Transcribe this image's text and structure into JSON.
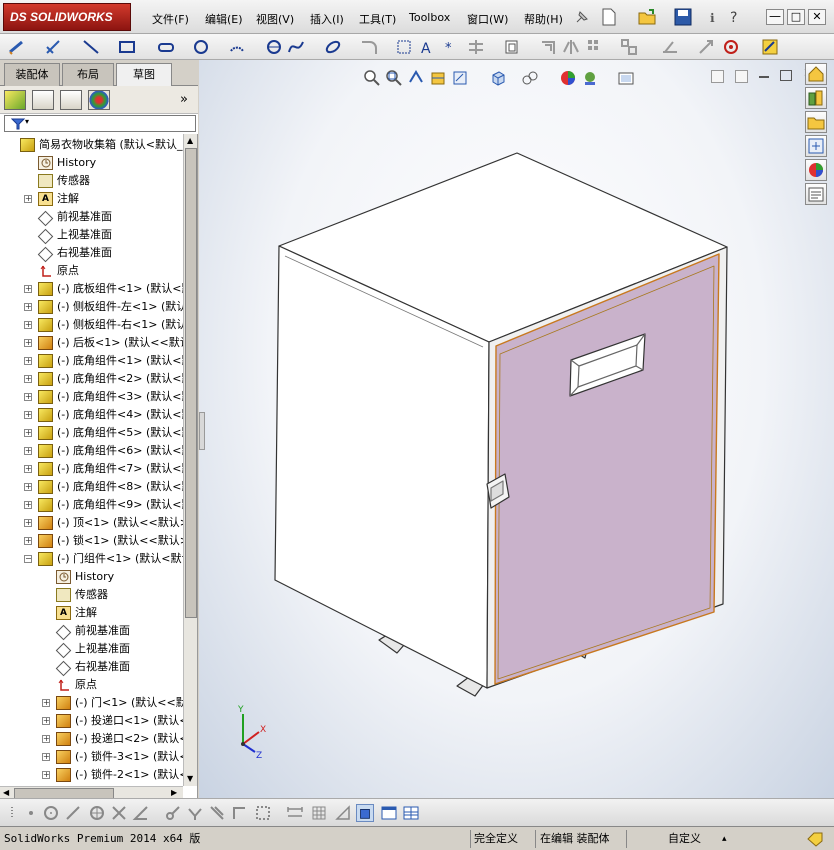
{
  "app": {
    "logo_text": "DS SOLIDWORKS"
  },
  "menu": {
    "items": [
      "文件(F)",
      "编辑(E)",
      "视图(V)",
      "插入(I)",
      "工具(T)",
      "Toolbox",
      "窗口(W)",
      "帮助(H)"
    ]
  },
  "window_buttons": {
    "minimize": "—",
    "restore": "□",
    "close": "✕"
  },
  "left_tabs": [
    "装配体",
    "布局",
    "草图"
  ],
  "active_tab": "草图",
  "collapse_glyph": "»",
  "tree": [
    {
      "label": "简易衣物收集箱  (默认<默认_",
      "icon": "asm",
      "expand": "",
      "indent": 0
    },
    {
      "label": "History",
      "icon": "hist",
      "expand": "",
      "indent": 1
    },
    {
      "label": "传感器",
      "icon": "sens",
      "expand": "",
      "indent": 1
    },
    {
      "label": "注解",
      "icon": "ann",
      "expand": "+",
      "indent": 1
    },
    {
      "label": "前视基准面",
      "icon": "plane",
      "expand": "",
      "indent": 1
    },
    {
      "label": "上视基准面",
      "icon": "plane",
      "expand": "",
      "indent": 1
    },
    {
      "label": "右视基准面",
      "icon": "plane",
      "expand": "",
      "indent": 1
    },
    {
      "label": "原点",
      "icon": "orig",
      "expand": "",
      "indent": 1
    },
    {
      "label": "(-) 底板组件<1> (默认<默",
      "icon": "asm",
      "expand": "+",
      "indent": 1
    },
    {
      "label": "(-) 侧板组件-左<1> (默认",
      "icon": "asm",
      "expand": "+",
      "indent": 1
    },
    {
      "label": "(-) 侧板组件-右<1> (默认",
      "icon": "asm",
      "expand": "+",
      "indent": 1
    },
    {
      "label": "(-) 后板<1> (默认<<默认",
      "icon": "part",
      "expand": "+",
      "indent": 1
    },
    {
      "label": "(-) 底角组件<1> (默认<默",
      "icon": "asm",
      "expand": "+",
      "indent": 1
    },
    {
      "label": "(-) 底角组件<2> (默认<默",
      "icon": "asm",
      "expand": "+",
      "indent": 1
    },
    {
      "label": "(-) 底角组件<3> (默认<默",
      "icon": "asm",
      "expand": "+",
      "indent": 1
    },
    {
      "label": "(-) 底角组件<4> (默认<默",
      "icon": "asm",
      "expand": "+",
      "indent": 1
    },
    {
      "label": "(-) 底角组件<5> (默认<默",
      "icon": "asm",
      "expand": "+",
      "indent": 1
    },
    {
      "label": "(-) 底角组件<6> (默认<默",
      "icon": "asm",
      "expand": "+",
      "indent": 1
    },
    {
      "label": "(-) 底角组件<7> (默认<默",
      "icon": "asm",
      "expand": "+",
      "indent": 1
    },
    {
      "label": "(-) 底角组件<8> (默认<默",
      "icon": "asm",
      "expand": "+",
      "indent": 1
    },
    {
      "label": "(-) 底角组件<9> (默认<默",
      "icon": "asm",
      "expand": "+",
      "indent": 1
    },
    {
      "label": "(-) 顶<1> (默认<<默认>_",
      "icon": "part",
      "expand": "+",
      "indent": 1
    },
    {
      "label": "(-) 锁<1> (默认<<默认>_",
      "icon": "part",
      "expand": "+",
      "indent": 1
    },
    {
      "label": "(-) 门组件<1> (默认<默认",
      "icon": "asm",
      "expand": "−",
      "indent": 1
    },
    {
      "label": "History",
      "icon": "hist",
      "expand": "",
      "indent": 2
    },
    {
      "label": "传感器",
      "icon": "sens",
      "expand": "",
      "indent": 2
    },
    {
      "label": "注解",
      "icon": "ann",
      "expand": "",
      "indent": 2
    },
    {
      "label": "前视基准面",
      "icon": "plane",
      "expand": "",
      "indent": 2
    },
    {
      "label": "上视基准面",
      "icon": "plane",
      "expand": "",
      "indent": 2
    },
    {
      "label": "右视基准面",
      "icon": "plane",
      "expand": "",
      "indent": 2
    },
    {
      "label": "原点",
      "icon": "orig",
      "expand": "",
      "indent": 2
    },
    {
      "label": "(-) 门<1> (默认<<默认",
      "icon": "part",
      "expand": "+",
      "indent": 2
    },
    {
      "label": "(-) 投递口<1> (默认<",
      "icon": "part",
      "expand": "+",
      "indent": 2
    },
    {
      "label": "(-) 投递口<2> (默认<",
      "icon": "part",
      "expand": "+",
      "indent": 2
    },
    {
      "label": "(-) 锁件-3<1> (默认<",
      "icon": "part",
      "expand": "+",
      "indent": 2
    },
    {
      "label": "(-) 锁件-2<1> (默认<",
      "icon": "part",
      "expand": "+",
      "indent": 2
    }
  ],
  "axis_labels": {
    "x": "X",
    "y": "Y",
    "z": "Z"
  },
  "status": {
    "product": "SolidWorks Premium 2014 x64 版",
    "definition": "完全定义",
    "editing": "在编辑 装配体",
    "units": "自定义",
    "units_arrow": "▴"
  },
  "colors": {
    "door_panel": "#c9b2cb",
    "door_edge": "#c8781e",
    "accent_red": "#c0201a"
  }
}
